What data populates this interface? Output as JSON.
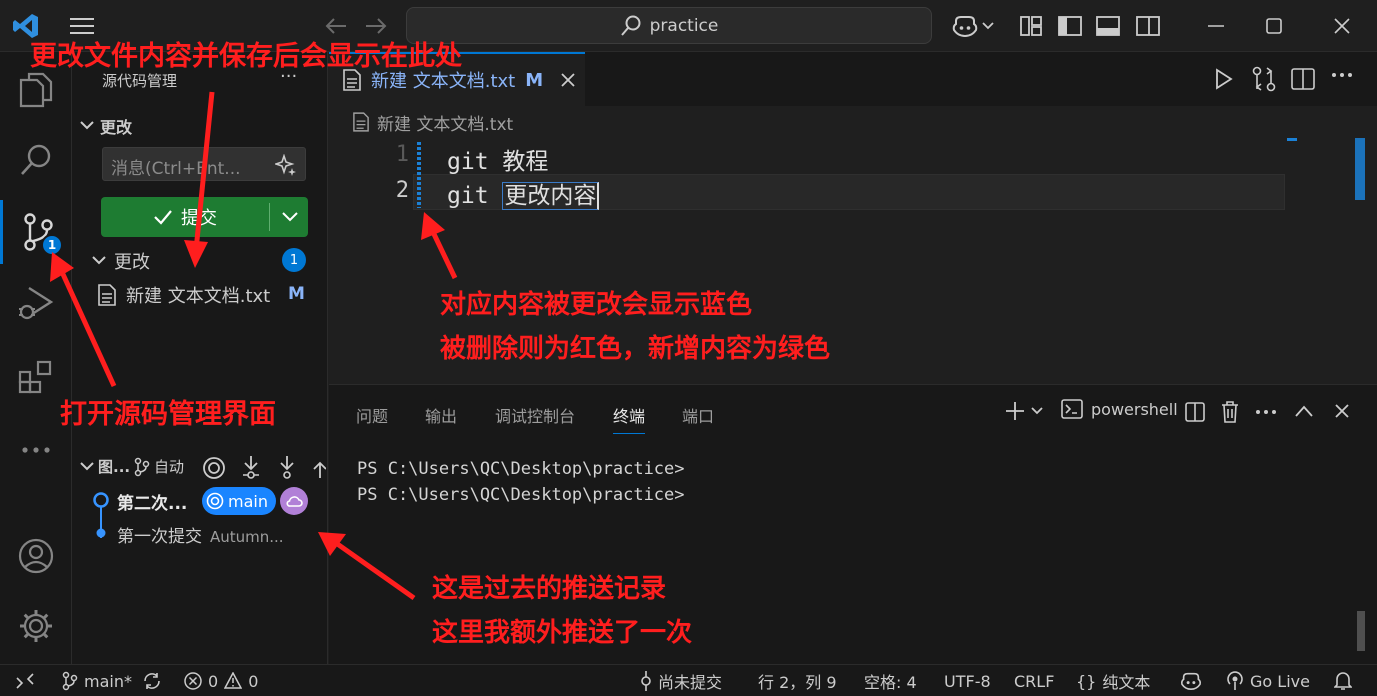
{
  "titlebar": {
    "search_text": "practice",
    "icons": [
      "vscode-logo-icon",
      "menu-icon",
      "back-arrow-icon",
      "forward-arrow-icon",
      "search-icon",
      "copilot-icon",
      "chevron-down-icon",
      "customize-layout-icon",
      "toggle-sidebar-icon",
      "toggle-panel-icon",
      "toggle-secondary-sidebar-icon",
      "minimize-icon",
      "maximize-icon",
      "close-icon"
    ]
  },
  "activitybar": {
    "scm_badge": "1",
    "icons": [
      "explorer-icon",
      "search-icon",
      "source-control-icon",
      "run-debug-icon",
      "extensions-icon",
      "more-icon",
      "account-icon",
      "settings-icon"
    ]
  },
  "sidebar": {
    "title": "源代码管理",
    "more": "···",
    "section_title": "更改",
    "commit_placeholder": "消息(Ctrl+Ent...",
    "commit_label": "提交",
    "changes_group": "更改",
    "changes_count": "1",
    "file_name": "新建 文本文档.txt",
    "file_status": "M",
    "graph": {
      "title": "图...",
      "auto_label": "自动",
      "commits": [
        {
          "message": "第二次...",
          "branch": "main"
        },
        {
          "message": "第一次提交",
          "author": "Autumn..."
        }
      ]
    }
  },
  "editor": {
    "tab_label": "新建 文本文档.txt",
    "tab_status": "M",
    "breadcrumb": "新建 文本文档.txt",
    "lines": [
      {
        "number": "1",
        "text": "git 教程"
      },
      {
        "number": "2",
        "text_prefix": "git ",
        "text_highlight": "更改内容"
      }
    ]
  },
  "panel": {
    "tabs": [
      "问题",
      "输出",
      "调试控制台",
      "终端",
      "端口"
    ],
    "active_tab": "终端",
    "shell": "powershell",
    "terminal_lines": [
      "PS C:\\Users\\QC\\Desktop\\practice>",
      "PS C:\\Users\\QC\\Desktop\\practice>"
    ]
  },
  "statusbar": {
    "branch": "main*",
    "errors": "0",
    "warnings": "0",
    "commit_status": "尚未提交",
    "position": "行 2，列 9",
    "spaces": "空格: 4",
    "encoding": "UTF-8",
    "eol": "CRLF",
    "braces": "{}",
    "language": "纯文本",
    "golive": "Go Live"
  },
  "annotations": {
    "save_note": "更改文件内容并保存后会显示在此处",
    "color_note_1": "对应内容被更改会显示蓝色",
    "color_note_2": "被删除则为红色，新增内容为绿色",
    "scm_note": "打开源码管理界面",
    "history_note_1": "这是过去的推送记录",
    "history_note_2": "这里我额外推送了一次"
  },
  "colors": {
    "accent": "#0078d4",
    "commit_button": "#1e7c32",
    "annotation": "#ff1e1e",
    "modified_gutter": "#1b81d6"
  }
}
